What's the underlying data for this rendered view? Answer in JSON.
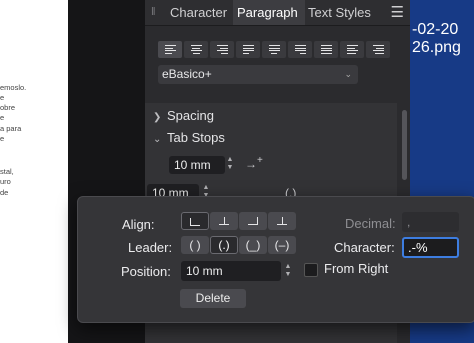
{
  "document": {
    "lines": [
      "emoslo.",
      "e",
      "obre",
      "e",
      "a para",
      "e",
      "stal,",
      "uro",
      "de"
    ]
  },
  "panel": {
    "tabs": [
      "Character",
      "Paragraph",
      "Text Styles"
    ],
    "active_tab": "Paragraph",
    "font_select": "eBasico+",
    "sections": {
      "spacing": "Spacing",
      "tab_stops": "Tab Stops"
    },
    "tab_stop_position": "10 mm",
    "partial_row": {
      "value": "10 mm",
      "glyphs": [
        "(.)"
      ]
    }
  },
  "desktop": {
    "file_line1": "-02-20",
    "file_line2": "26.png",
    "accent": "#173a86"
  },
  "popup": {
    "align_label": "Align:",
    "leader_label": "Leader:",
    "leader_options": [
      "( )",
      "(.)",
      "(_)",
      "(–)"
    ],
    "leader_selected": "(.)",
    "position_label": "Position:",
    "position_value": "10 mm",
    "decimal_label": "Decimal:",
    "decimal_value": ",",
    "character_label": "Character:",
    "character_value": ".-%",
    "from_right_label": "From Right",
    "delete_label": "Delete",
    "focus_color": "#3d7de0"
  }
}
